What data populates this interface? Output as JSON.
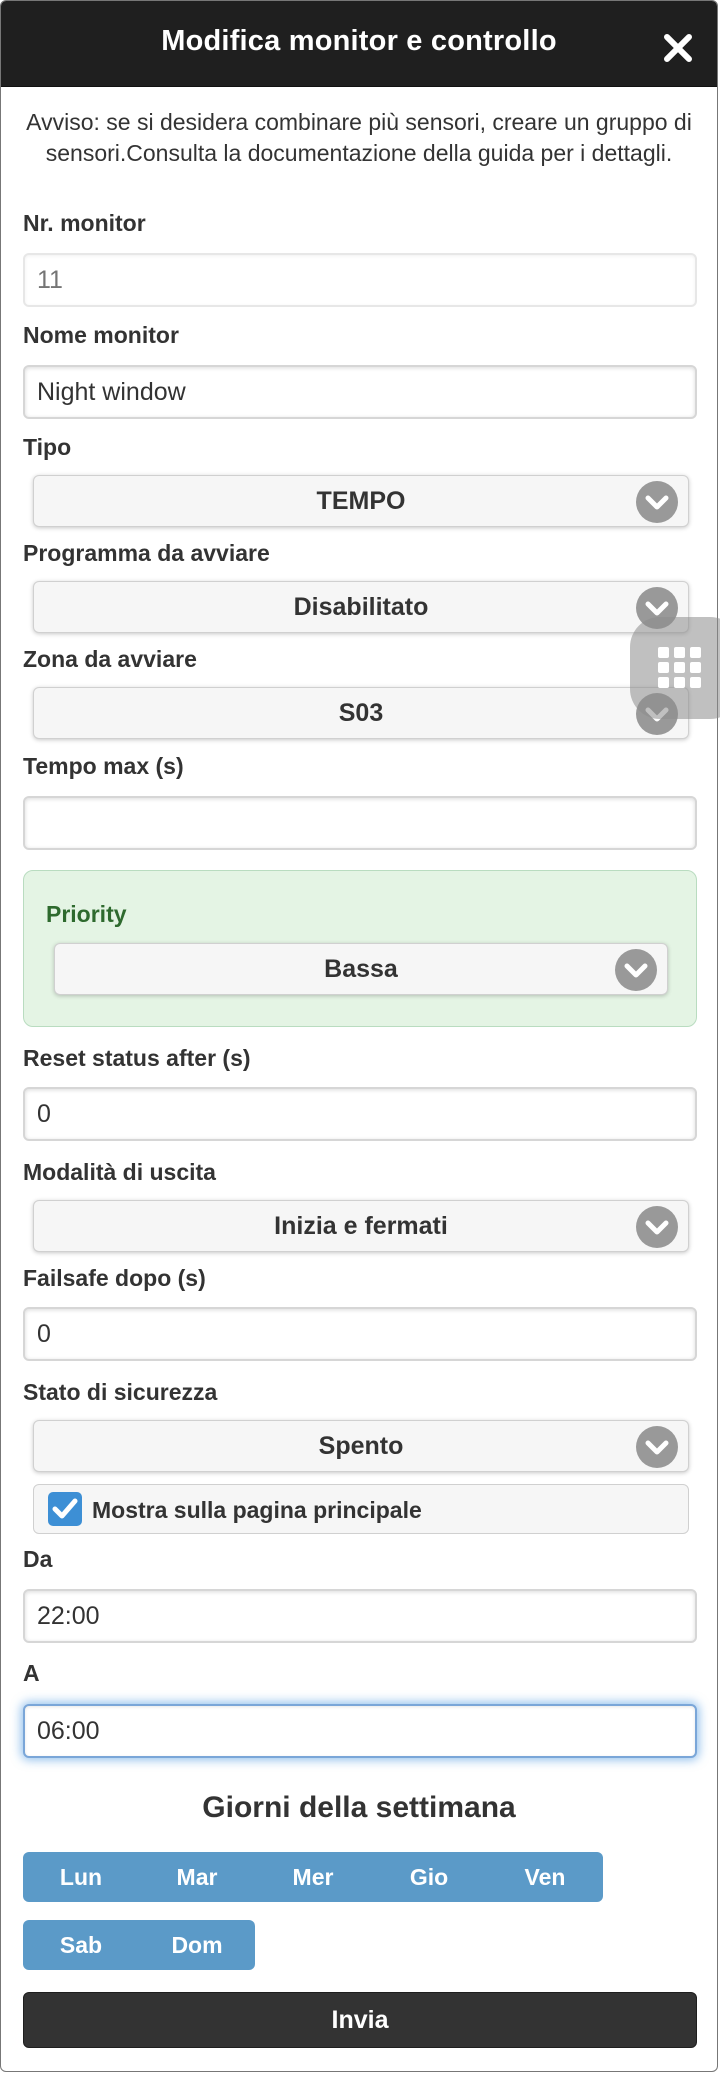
{
  "dialog": {
    "title": "Modifica monitor e controllo",
    "notice": "Avviso: se si desidera combinare più sensori, creare un gruppo di sensori.Consulta la documentazione della guida per i dettagli."
  },
  "fields": {
    "monitor_nr": {
      "label": "Nr. monitor",
      "placeholder": "11"
    },
    "monitor_name": {
      "label": "Nome monitor",
      "value": "Night window"
    },
    "type": {
      "label": "Tipo",
      "value": "TEMPO"
    },
    "program": {
      "label": "Programma da avviare",
      "value": "Disabilitato"
    },
    "zone": {
      "label": "Zona da avviare",
      "value": "S03"
    },
    "max_time": {
      "label": "Tempo max (s)",
      "value": ""
    },
    "priority": {
      "label": "Priority",
      "value": "Bassa"
    },
    "reset_after": {
      "label": "Reset status after (s)",
      "value": "0"
    },
    "output_mode": {
      "label": "Modalità di uscita",
      "value": "Inizia e fermati"
    },
    "failsafe_after": {
      "label": "Failsafe dopo (s)",
      "value": "0"
    },
    "safe_state": {
      "label": "Stato di sicurezza",
      "value": "Spento"
    },
    "show_main": {
      "label": "Mostra sulla pagina principale",
      "checked": true
    },
    "from": {
      "label": "Da",
      "value": "22:00"
    },
    "to": {
      "label": "A",
      "value": "06:00"
    }
  },
  "weekdays": {
    "title": "Giorni della settimana",
    "row1": [
      "Lun",
      "Mar",
      "Mer",
      "Gio",
      "Ven"
    ],
    "row2": [
      "Sab",
      "Dom"
    ]
  },
  "submit_label": "Invia",
  "icons": {
    "close": "close-icon",
    "chevron": "chevron-down-icon",
    "checkbox": "checkmark-icon",
    "fab": "grid-icon"
  },
  "colors": {
    "header_bg": "#1f1f1f",
    "accent_blue": "#5b9ac8",
    "checkbox_blue": "#3d8fd5",
    "priority_bg": "#e4f4e4",
    "priority_text": "#2e6a2e",
    "submit_bg": "#333333"
  }
}
